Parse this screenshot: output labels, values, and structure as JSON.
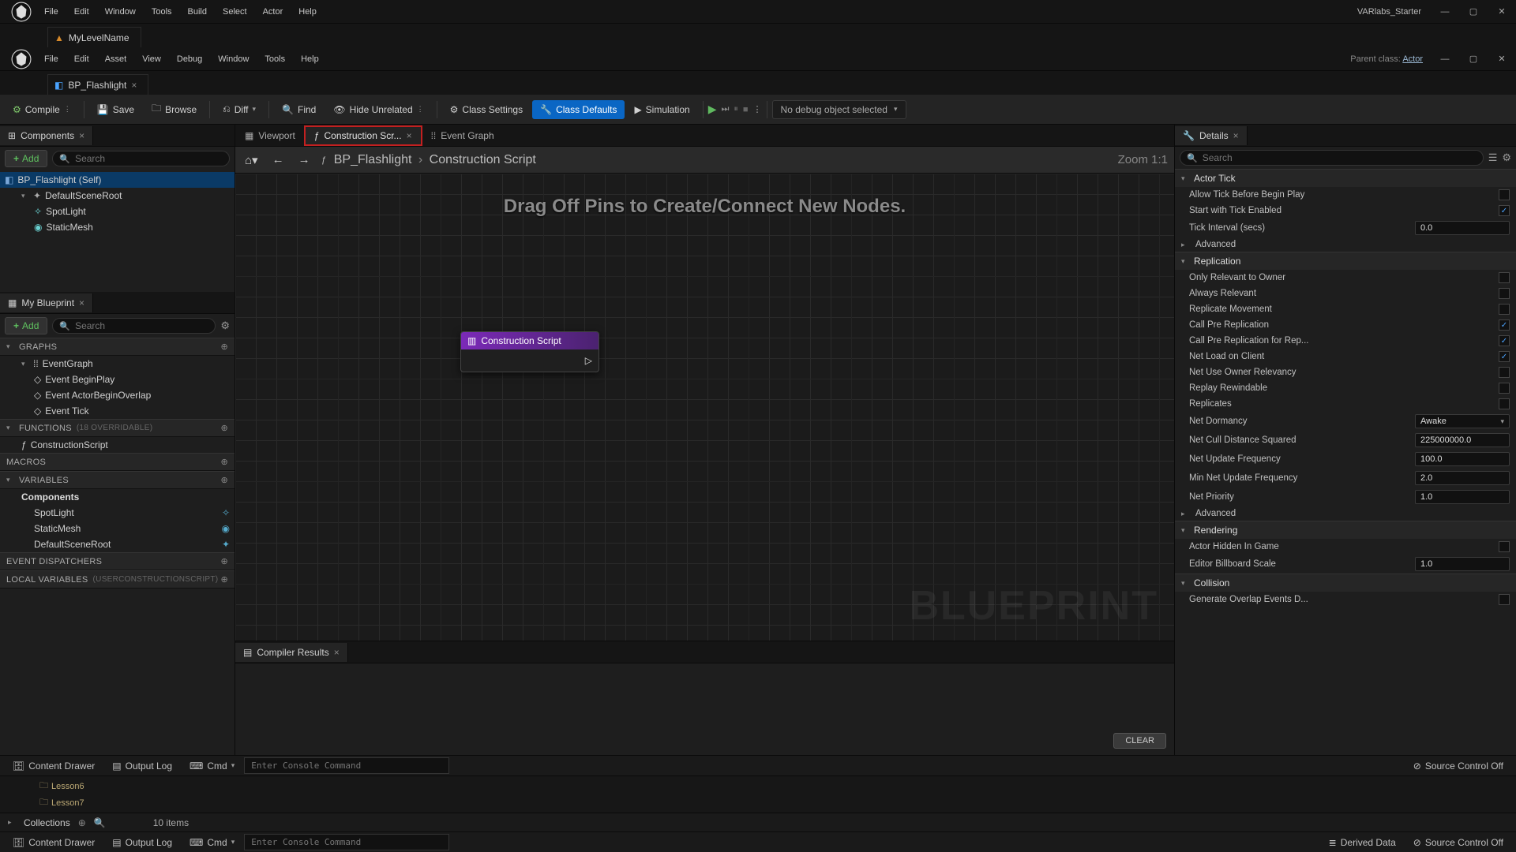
{
  "project_name": "VARlabs_Starter",
  "parent_class_label": "Parent class:",
  "parent_class": "Actor",
  "outer_tab": "MyLevelName",
  "inner_tab": "BP_Flashlight",
  "menu_outer": [
    "File",
    "Edit",
    "Window",
    "Tools",
    "Build",
    "Select",
    "Actor",
    "Help"
  ],
  "menu_inner": [
    "File",
    "Edit",
    "Asset",
    "View",
    "Debug",
    "Window",
    "Tools",
    "Help"
  ],
  "toolbar": {
    "compile": "Compile",
    "save": "Save",
    "browse": "Browse",
    "diff": "Diff",
    "find": "Find",
    "hide_unrelated": "Hide Unrelated",
    "class_settings": "Class Settings",
    "class_defaults": "Class Defaults",
    "simulation": "Simulation",
    "debug_selector": "No debug object selected"
  },
  "left": {
    "components_tab": "Components",
    "add": "Add",
    "search_placeholder": "Search",
    "tree": {
      "root": "BP_Flashlight (Self)",
      "scene_root": "DefaultSceneRoot",
      "child1": "SpotLight",
      "child2": "StaticMesh"
    },
    "myblueprint_tab": "My Blueprint",
    "graphs_label": "GRAPHS",
    "eventgraph": "EventGraph",
    "events": [
      "Event BeginPlay",
      "Event ActorBeginOverlap",
      "Event Tick"
    ],
    "functions_label": "FUNCTIONS",
    "functions_hint": "(18 OVERRIDABLE)",
    "construction_script": "ConstructionScript",
    "macros_label": "MACROS",
    "variables_label": "VARIABLES",
    "vars_components": "Components",
    "vars": [
      "SpotLight",
      "StaticMesh",
      "DefaultSceneRoot"
    ],
    "dispatchers_label": "EVENT DISPATCHERS",
    "locals_label": "LOCAL VARIABLES",
    "locals_hint": "(USERCONSTRUCTIONSCRIPT)"
  },
  "center": {
    "tabs": {
      "viewport": "Viewport",
      "construction": "Construction Scr...",
      "eventgraph": "Event Graph"
    },
    "bc_asset": "BP_Flashlight",
    "bc_graph": "Construction Script",
    "zoom": "Zoom 1:1",
    "hint": "Drag Off Pins to Create/Connect New Nodes.",
    "node_title": "Construction Script",
    "watermark": "BLUEPRINT",
    "compiler_tab": "Compiler Results",
    "clear": "CLEAR"
  },
  "details": {
    "tab": "Details",
    "search_placeholder": "Search",
    "cat_actor_tick": "Actor Tick",
    "allow_tick": "Allow Tick Before Begin Play",
    "start_tick": "Start with Tick Enabled",
    "tick_interval_label": "Tick Interval (secs)",
    "tick_interval": "0.0",
    "advanced": "Advanced",
    "cat_replication": "Replication",
    "only_owner": "Only Relevant to Owner",
    "always_relevant": "Always Relevant",
    "replicate_movement": "Replicate Movement",
    "call_pre": "Call Pre Replication",
    "call_pre_for": "Call Pre Replication for Rep...",
    "net_load": "Net Load on Client",
    "net_owner": "Net Use Owner Relevancy",
    "replay": "Replay Rewindable",
    "replicates": "Replicates",
    "net_dormancy_label": "Net Dormancy",
    "net_dormancy": "Awake",
    "cull_label": "Net Cull Distance Squared",
    "cull": "225000000.0",
    "update_freq_label": "Net Update Frequency",
    "update_freq": "100.0",
    "min_update_label": "Min Net Update Frequency",
    "min_update": "2.0",
    "net_priority_label": "Net Priority",
    "net_priority": "1.0",
    "cat_rendering": "Rendering",
    "hidden": "Actor Hidden In Game",
    "billboard_label": "Editor Billboard Scale",
    "billboard": "1.0",
    "cat_collision": "Collision",
    "gen_overlap": "Generate Overlap Events D..."
  },
  "bottom": {
    "content_drawer": "Content Drawer",
    "output_log": "Output Log",
    "cmd": "Cmd",
    "cmd_placeholder": "Enter Console Command",
    "source_control": "Source Control Off",
    "derived_data": "Derived Data",
    "folders": [
      "Lesson6",
      "Lesson7"
    ],
    "collections": "Collections",
    "item_count": "10 items"
  }
}
